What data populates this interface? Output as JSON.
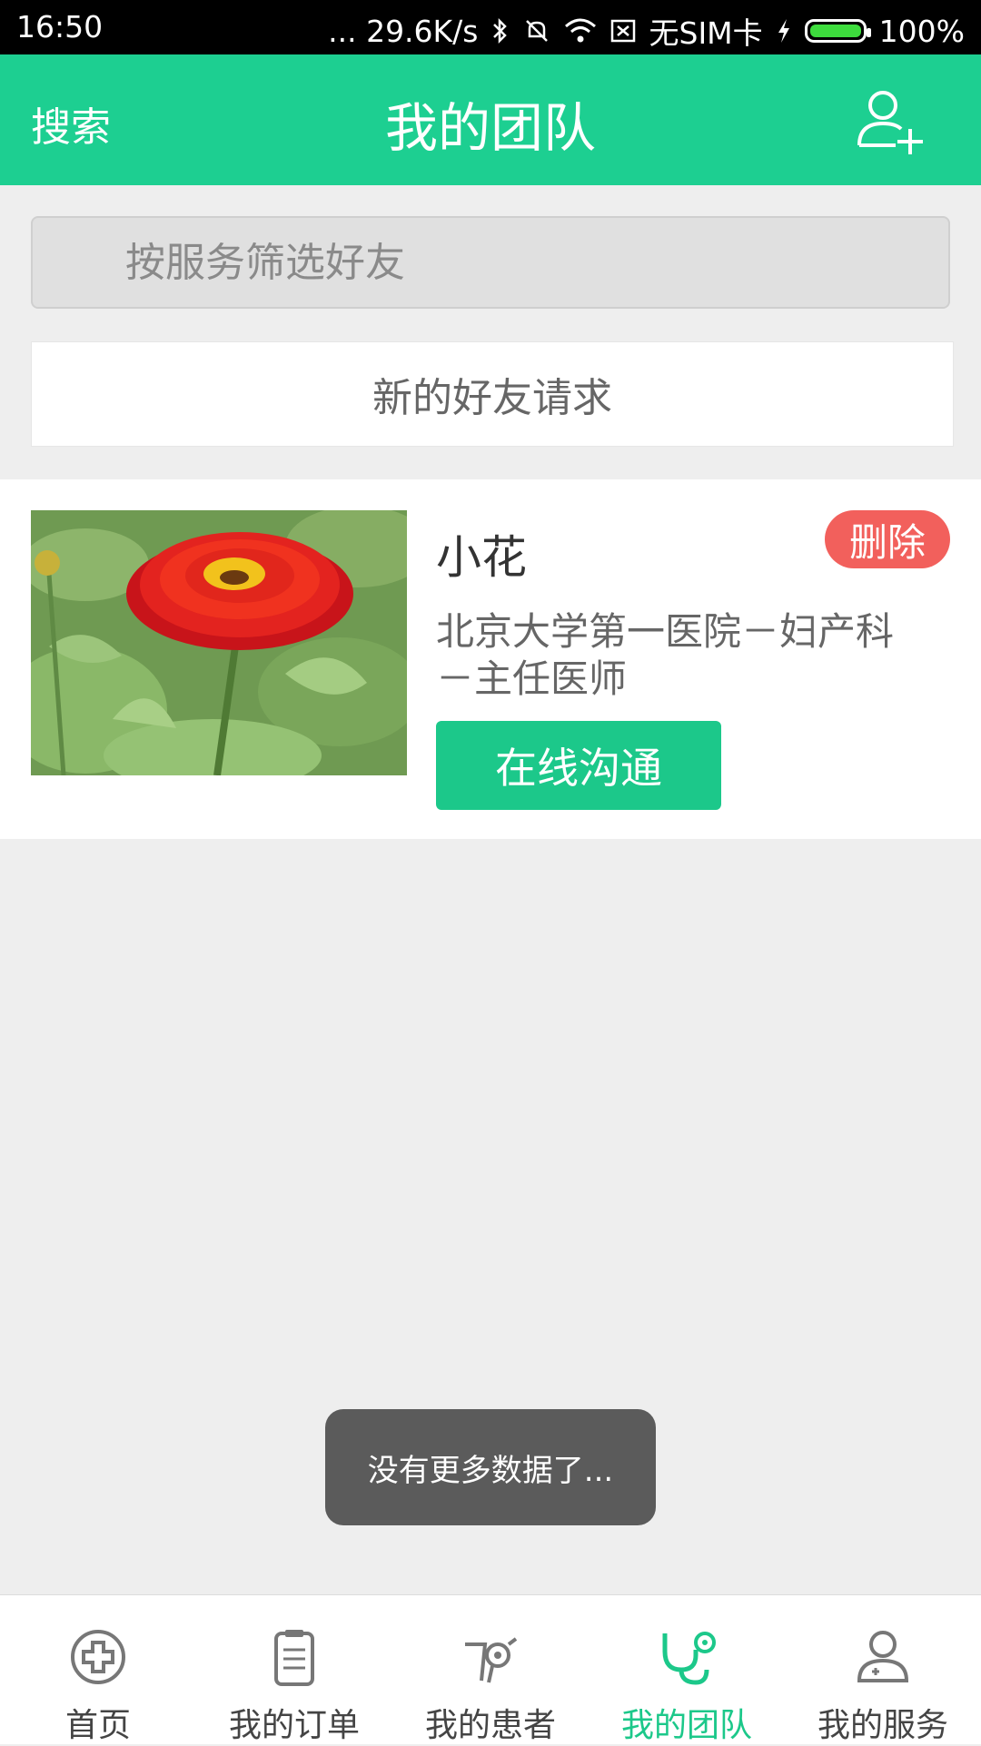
{
  "status_bar": {
    "time": "16:50",
    "network_speed": "... 29.6K/s",
    "sim": "无SIM卡",
    "battery": "100%",
    "battery_level": 1.0
  },
  "header": {
    "search_label": "搜索",
    "title": "我的团队",
    "add_icon": "add-user-icon"
  },
  "filter": {
    "placeholder": "按服务筛选好友",
    "value": ""
  },
  "new_requests_label": "新的好友请求",
  "friends": [
    {
      "name": "小花",
      "delete_label": "删除",
      "description": "北京大学第一医院－妇产科－主任医师",
      "chat_label": "在线沟通"
    }
  ],
  "toast": "没有更多数据了...",
  "tabs": [
    {
      "label": "首页",
      "icon": "home-cross-icon"
    },
    {
      "label": "我的订单",
      "icon": "clipboard-icon"
    },
    {
      "label": "我的患者",
      "icon": "patient-icon"
    },
    {
      "label": "我的团队",
      "icon": "stethoscope-icon",
      "active": true
    },
    {
      "label": "我的服务",
      "icon": "user-service-icon"
    }
  ],
  "colors": {
    "accent": "#1dcf91",
    "delete": "#f2605c",
    "toast_bg": "#5b5b5b"
  }
}
